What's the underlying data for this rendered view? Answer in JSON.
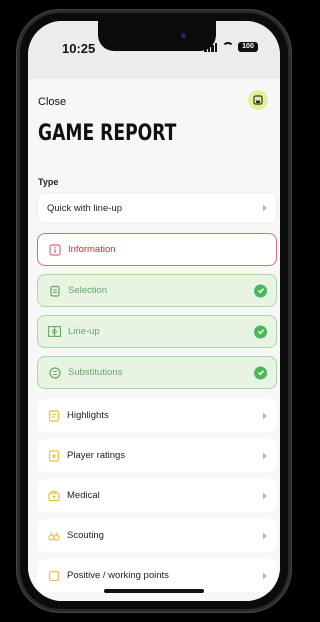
{
  "status": {
    "time": "10:25",
    "battery": "100"
  },
  "header": {
    "close_label": "Close",
    "title": "GAME REPORT"
  },
  "type_section": {
    "label": "Type",
    "value": "Quick with line-up"
  },
  "items": [
    {
      "label": "Information",
      "state": "active",
      "icon": "info-icon"
    },
    {
      "label": "Selection",
      "state": "completed",
      "icon": "clipboard-icon"
    },
    {
      "label": "Line-up",
      "state": "completed",
      "icon": "pitch-icon"
    },
    {
      "label": "Substitutions",
      "state": "completed",
      "icon": "swap-icon"
    },
    {
      "label": "Highlights",
      "state": "default",
      "icon": "notes-icon"
    },
    {
      "label": "Player ratings",
      "state": "default",
      "icon": "rating-icon"
    },
    {
      "label": "Medical",
      "state": "default",
      "icon": "medkit-icon"
    },
    {
      "label": "Scouting",
      "state": "default",
      "icon": "binoculars-icon"
    },
    {
      "label": "Positive / working points",
      "state": "default",
      "icon": "square-icon"
    }
  ],
  "colors": {
    "accent_red": "#e06b74",
    "accent_green": "#4db85a",
    "icon_yellow": "#e9c33a",
    "save_bg": "#e8ef9a"
  }
}
